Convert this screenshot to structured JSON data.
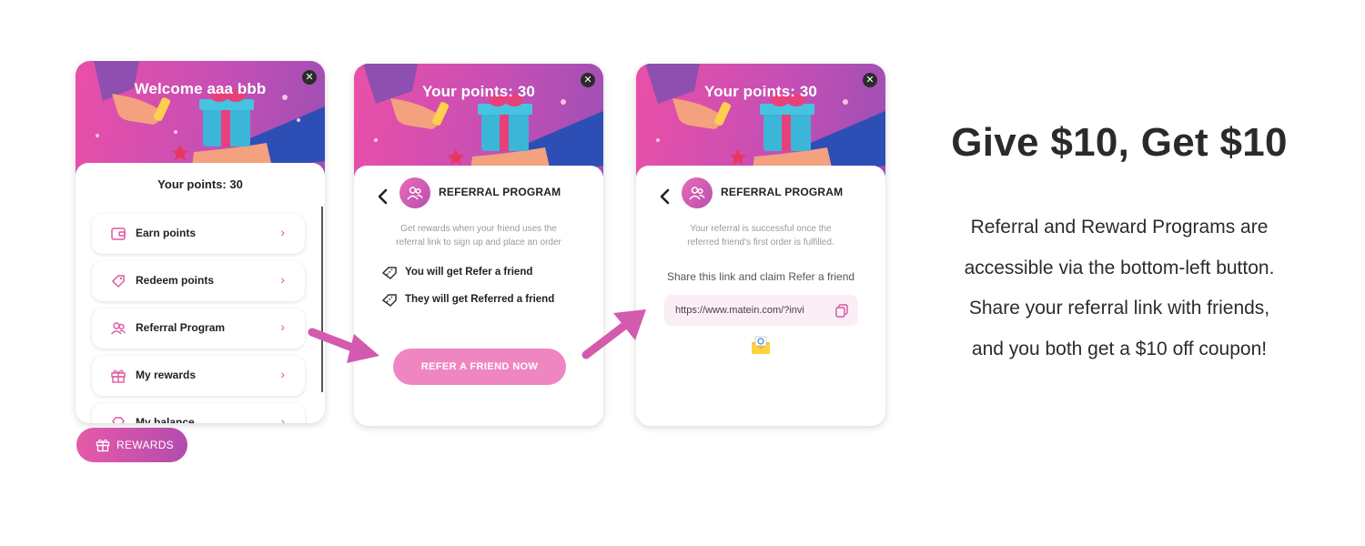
{
  "card1": {
    "header_title": "Welcome aaa bbb",
    "points_text": "Your points: 30",
    "menu": [
      {
        "label": "Earn points",
        "icon": "wallet-icon"
      },
      {
        "label": "Redeem points",
        "icon": "tag-icon"
      },
      {
        "label": "Referral Program",
        "icon": "users-icon"
      },
      {
        "label": "My rewards",
        "icon": "gift-icon"
      },
      {
        "label": "My balance",
        "icon": "diamond-icon"
      }
    ]
  },
  "card2": {
    "header_title": "Your points: 30",
    "program_title": "REFERRAL PROGRAM",
    "description_lines": [
      "Get rewards when your friend uses the",
      "referral link to sign up and place an order"
    ],
    "benefits": [
      {
        "label": "You will get Refer a friend",
        "icon": "coupon-icon"
      },
      {
        "label": "They will get Referred a friend",
        "icon": "coupon-icon"
      }
    ],
    "cta_label": "REFER A FRIEND NOW"
  },
  "card3": {
    "header_title": "Your points: 30",
    "program_title": "REFERRAL PROGRAM",
    "description_lines": [
      "Your referral is successful once the",
      "referred friend's first order is fulfilled."
    ],
    "share_text": "Share this link and claim Refer a friend",
    "link_value": "https://www.matein.com/?invi",
    "icons": [
      "copy-icon",
      "email-icon"
    ]
  },
  "rewards_button": {
    "label": "REWARDS",
    "icon": "gift-icon"
  },
  "promo": {
    "headline": "Give $10, Get $10",
    "body_lines": [
      "Referral and Reward Programs are",
      "accessible via the bottom-left button.",
      "Share your referral link with friends,",
      "and you both get a $10 off coupon!"
    ]
  },
  "colors": {
    "accent_pink": "#e05aa6",
    "cta_pink": "#ef86c2",
    "arrow": "#d35aae",
    "text": "#2a2a2a"
  }
}
